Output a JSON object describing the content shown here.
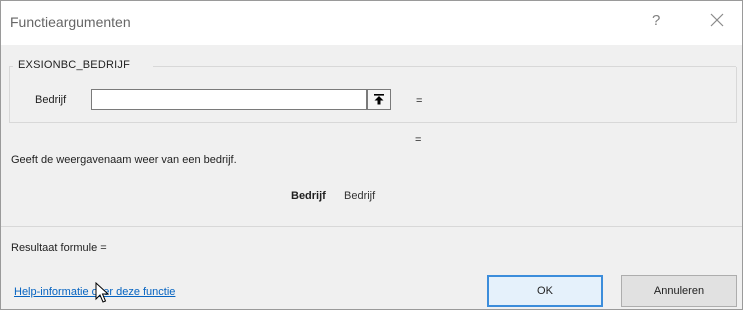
{
  "window": {
    "title": "Functieargumenten",
    "help_button": "?"
  },
  "function": {
    "name": "EXSIONBC_BEDRIJF",
    "argument_label": "Bedrijf",
    "argument_value": "",
    "argument_equals": "=",
    "function_equals": "=",
    "description": "Geeft de weergavenaam weer van een bedrijf.",
    "argument_help_name": "Bedrijf",
    "argument_help_text": "Bedrijf"
  },
  "footer": {
    "result_label": "Resultaat formule =",
    "help_link": "Help-informatie over deze functie",
    "ok_label": "OK",
    "cancel_label": "Annuleren"
  },
  "colors": {
    "link": "#0563c1",
    "ok_border": "#3c8ddb"
  },
  "icons": [
    "close-icon",
    "collapse-dialog-icon",
    "mouse-pointer-icon"
  ]
}
